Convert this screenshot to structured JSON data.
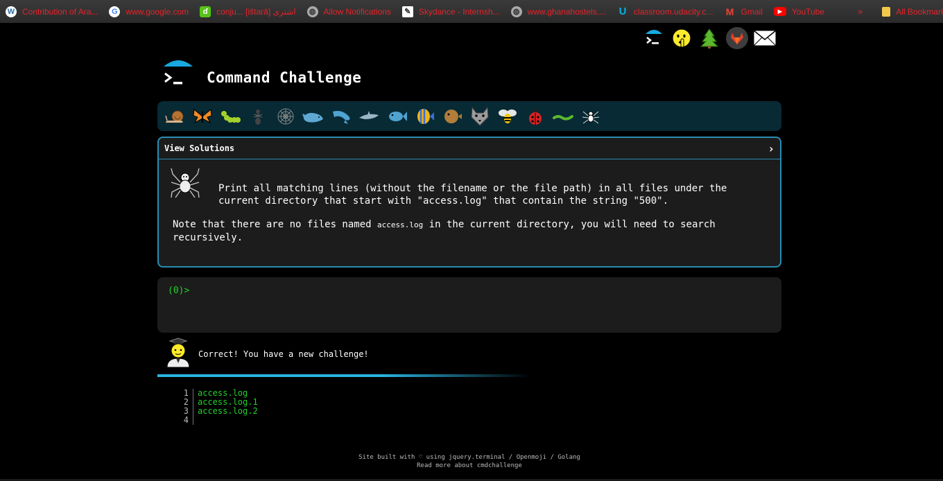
{
  "bookmarks": [
    {
      "label": "Contribution of Ara...",
      "icon": "wordpress-icon"
    },
    {
      "label": "www.google.com",
      "icon": "google-icon"
    },
    {
      "label": "conju... [ištarā] اشترى",
      "icon": "duolingo-icon"
    },
    {
      "label": "Allow Notifications",
      "icon": "globe-icon"
    },
    {
      "label": "Skydance - Internsh...",
      "icon": "edit-icon"
    },
    {
      "label": "www.ghanahostels....",
      "icon": "globe-icon"
    },
    {
      "label": "classroom.udacity.c...",
      "icon": "udacity-icon"
    },
    {
      "label": "Gmail",
      "icon": "gmail-icon"
    },
    {
      "label": "YouTube",
      "icon": "youtube-icon"
    }
  ],
  "bookmarks_more": "»",
  "all_bookmarks": "All Bookmarks",
  "top_icons": [
    "terminal-logo-icon",
    "shushing-face-icon",
    "tree-icon",
    "gitlab-icon",
    "mail-icon"
  ],
  "header": {
    "title": "Command Challenge"
  },
  "animals": [
    "snail-icon",
    "butterfly-icon",
    "caterpillar-icon",
    "ant-icon",
    "spider-web-icon",
    "whale-icon",
    "dolphin-icon",
    "dolphin-jump-icon",
    "fish-icon",
    "tropical-fish-icon",
    "pufferfish-icon",
    "wolf-icon",
    "bee-icon",
    "ladybug-icon",
    "worm-icon",
    "spider-icon"
  ],
  "challenge": {
    "head": "View Solutions",
    "chevron": "›",
    "desc1": "Print all matching lines (without the filename or the file path) in all files under the current directory that start with \"access.log\" that contain the string \"500\".",
    "desc2_pre": "Note that there are no files named ",
    "desc2_code": "access.log",
    "desc2_post": " in the current directory, you will need to search recursively."
  },
  "terminal": {
    "prompt": "(0)>"
  },
  "result": {
    "message": "Correct! You have a new challenge!"
  },
  "files": [
    {
      "num": "1",
      "name": "access.log"
    },
    {
      "num": "2",
      "name": "access.log.1"
    },
    {
      "num": "3",
      "name": "access.log.2"
    },
    {
      "num": "4",
      "name": ""
    }
  ],
  "footer": {
    "line1": "Site built with ♡ using jquery.terminal / Openmoji / Golang",
    "line2": "Read more about cmdchallenge"
  }
}
